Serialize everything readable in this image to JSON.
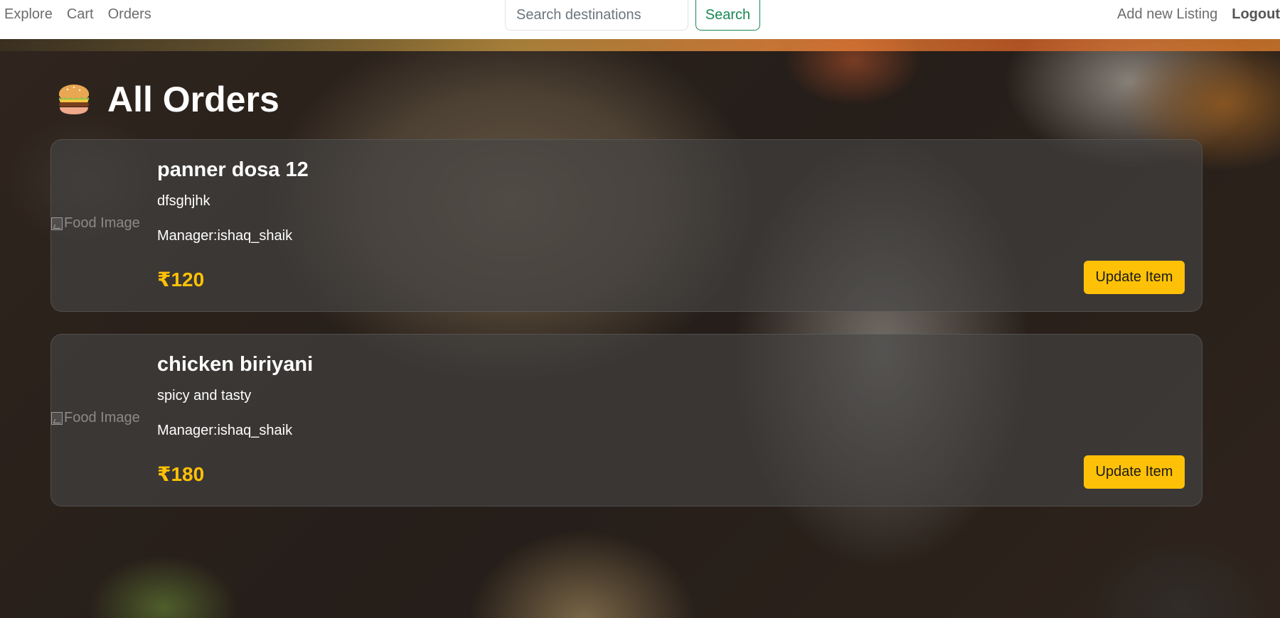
{
  "nav": {
    "left_links": [
      "Explore",
      "Cart",
      "Orders"
    ],
    "search_placeholder": "Search destinations",
    "search_button": "Search",
    "add_listing": "Add new Listing",
    "logout": "Logout"
  },
  "page": {
    "title_icon": "burger-emoji-icon",
    "title": "All Orders"
  },
  "orders": [
    {
      "image_alt": "Food Image",
      "name": "panner dosa 12",
      "description": "dfsghjhk",
      "manager": "Manager:ishaq_shaik",
      "price": "₹120",
      "button": "Update Item"
    },
    {
      "image_alt": "Food Image",
      "name": "chicken biriyani",
      "description": "spicy and tasty",
      "manager": "Manager:ishaq_shaik",
      "price": "₹180",
      "button": "Update Item"
    }
  ],
  "colors": {
    "accent_price": "#ffc107",
    "update_button": "#ffc107",
    "search_button": "#198754"
  }
}
